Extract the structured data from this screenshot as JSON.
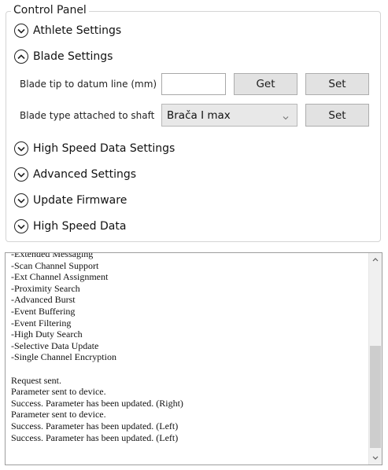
{
  "panel": {
    "title": "Control Panel",
    "sections": {
      "athlete": "Athlete Settings",
      "blade": "Blade Settings",
      "high_speed_settings": "High Speed Data Settings",
      "advanced": "Advanced Settings",
      "firmware": "Update Firmware",
      "high_speed_data": "High Speed Data"
    },
    "blade": {
      "tip_label": "Blade tip to datum line (mm)",
      "tip_value": "",
      "get_label": "Get",
      "set_label": "Set",
      "type_label": "Blade type attached to shaft",
      "type_selected": "Brača I max",
      "type_set_label": "Set"
    }
  },
  "log": {
    "lines": [
      "-Extended Messaging",
      "-Scan Channel Support",
      "-Ext Channel Assignment",
      "-Proximity Search",
      "-Advanced Burst",
      "-Event Buffering",
      "-Event Filtering",
      "-High Duty Search",
      "-Selective Data Update",
      "-Single Channel Encryption",
      "",
      "Request sent.",
      "Parameter sent to device.",
      "Success. Parameter has been updated. (Right)",
      "Parameter sent to device.",
      "Success. Parameter has been updated. (Left)",
      "Success. Parameter has been updated. (Left)"
    ]
  }
}
